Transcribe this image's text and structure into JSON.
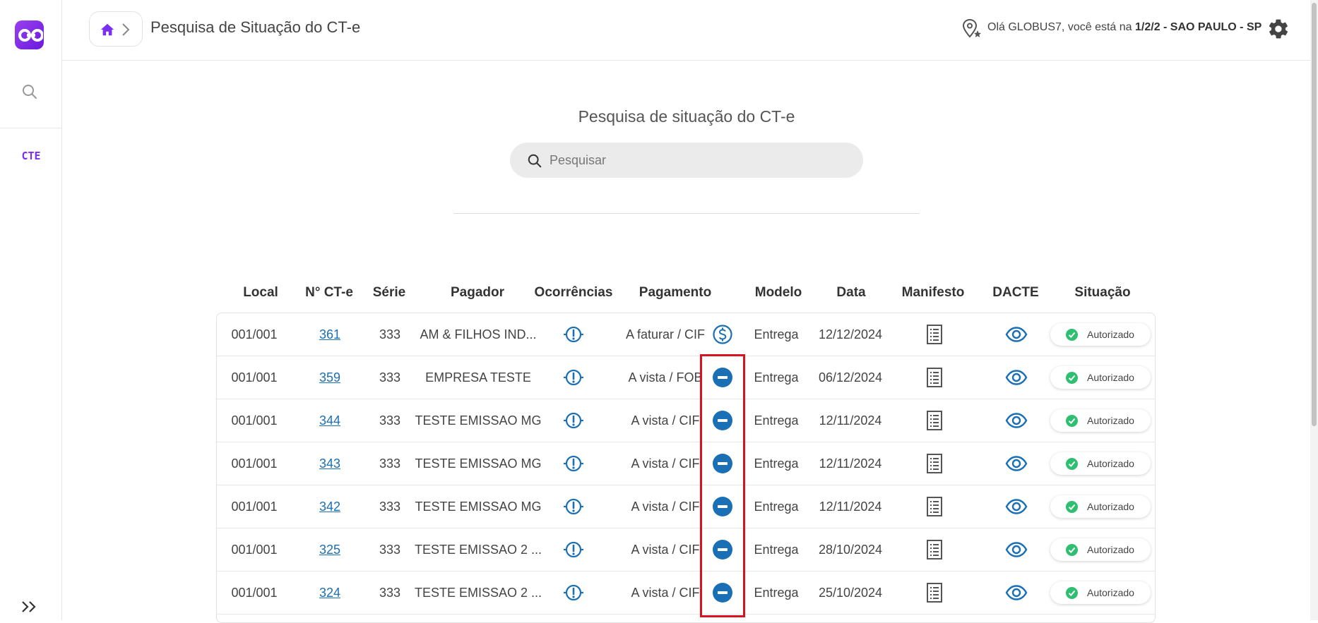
{
  "sidebar": {
    "module_label": "CTE"
  },
  "header": {
    "title": "Pesquisa de Situação do CT-e",
    "greeting_prefix": "Olá GLOBUS7, você está na",
    "greeting_location": "1/2/2 - SAO PAULO - SP"
  },
  "search": {
    "title": "Pesquisa de situação do CT-e",
    "placeholder": "Pesquisar"
  },
  "table": {
    "columns": [
      "Local",
      "N° CT-e",
      "Série",
      "Pagador",
      "Ocorrências",
      "Pagamento",
      "Modelo",
      "Data",
      "Manifesto",
      "DACTE",
      "Situação"
    ],
    "rows": [
      {
        "local": "001/001",
        "numero": "361",
        "serie": "333",
        "pagador": "AM & FILHOS IND...",
        "pagamento": "A faturar / CIF",
        "pagamento_icon": "dollar-circle-icon",
        "modelo": "Entrega",
        "data": "12/12/2024",
        "situacao": "Autorizado"
      },
      {
        "local": "001/001",
        "numero": "359",
        "serie": "333",
        "pagador": "EMPRESA TESTE",
        "pagamento": "A vista / FOB",
        "pagamento_icon": "minus-circle-icon",
        "modelo": "Entrega",
        "data": "06/12/2024",
        "situacao": "Autorizado"
      },
      {
        "local": "001/001",
        "numero": "344",
        "serie": "333",
        "pagador": "TESTE EMISSAO MG",
        "pagamento": "A vista / CIF",
        "pagamento_icon": "minus-circle-icon",
        "modelo": "Entrega",
        "data": "12/11/2024",
        "situacao": "Autorizado"
      },
      {
        "local": "001/001",
        "numero": "343",
        "serie": "333",
        "pagador": "TESTE EMISSAO MG",
        "pagamento": "A vista / CIF",
        "pagamento_icon": "minus-circle-icon",
        "modelo": "Entrega",
        "data": "12/11/2024",
        "situacao": "Autorizado"
      },
      {
        "local": "001/001",
        "numero": "342",
        "serie": "333",
        "pagador": "TESTE EMISSAO MG",
        "pagamento": "A vista / CIF",
        "pagamento_icon": "minus-circle-icon",
        "modelo": "Entrega",
        "data": "12/11/2024",
        "situacao": "Autorizado"
      },
      {
        "local": "001/001",
        "numero": "325",
        "serie": "333",
        "pagador": "TESTE EMISSAO 2 ...",
        "pagamento": "A vista / CIF",
        "pagamento_icon": "minus-circle-icon",
        "modelo": "Entrega",
        "data": "28/10/2024",
        "situacao": "Autorizado"
      },
      {
        "local": "001/001",
        "numero": "324",
        "serie": "333",
        "pagador": "TESTE EMISSAO 2 ...",
        "pagamento": "A vista / CIF",
        "pagamento_icon": "minus-circle-icon",
        "modelo": "Entrega",
        "data": "25/10/2024",
        "situacao": "Autorizado"
      }
    ]
  },
  "colors": {
    "brand": "#7b2ff0",
    "link": "#1a6fb5",
    "icon_blue": "#1a6fb5",
    "status_green": "#2fbf71",
    "highlight": "#d8121f"
  }
}
